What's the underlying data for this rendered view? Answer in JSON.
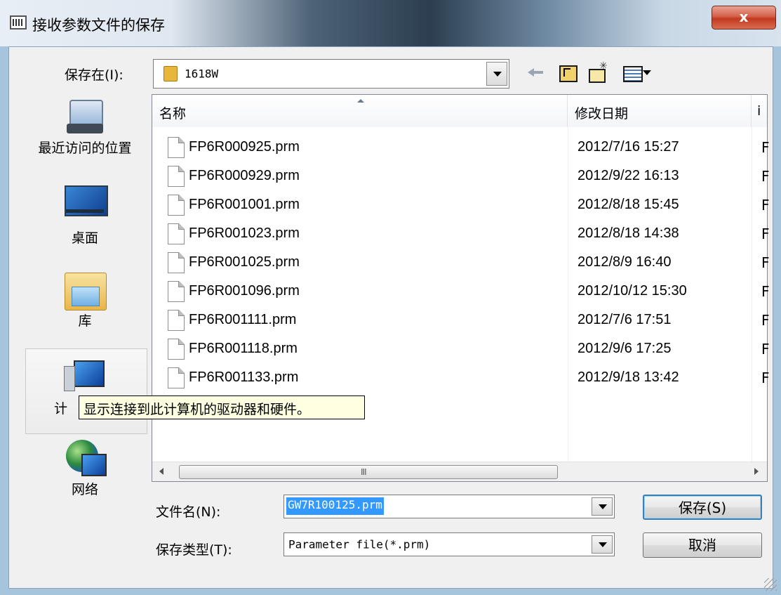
{
  "window": {
    "title": "接收参数文件的保存",
    "close_label": "x"
  },
  "save_in": {
    "label": "保存在(I):",
    "value": "1618W"
  },
  "places": [
    {
      "label": "最近访问的位置"
    },
    {
      "label": "桌面"
    },
    {
      "label": "库"
    },
    {
      "label": "计"
    },
    {
      "label": "网络"
    }
  ],
  "list": {
    "columns": [
      "名称",
      "修改日期",
      "i"
    ],
    "files": [
      {
        "name": "FP6R000925.prm",
        "date": "2012/7/16 15:27",
        "more": "F"
      },
      {
        "name": "FP6R000929.prm",
        "date": "2012/9/22 16:13",
        "more": "F"
      },
      {
        "name": "FP6R001001.prm",
        "date": "2012/8/18 15:45",
        "more": "F"
      },
      {
        "name": "FP6R001023.prm",
        "date": "2012/8/18 14:38",
        "more": "F"
      },
      {
        "name": "FP6R001025.prm",
        "date": "2012/8/9 16:40",
        "more": "F"
      },
      {
        "name": "FP6R001096.prm",
        "date": "2012/10/12 15:30",
        "more": "F"
      },
      {
        "name": "FP6R001111.prm",
        "date": "2012/7/6 17:51",
        "more": "F"
      },
      {
        "name": "FP6R001118.prm",
        "date": "2012/9/6 17:25",
        "more": "F"
      },
      {
        "name": "FP6R001133.prm",
        "date": "2012/9/18 13:42",
        "more": "F"
      }
    ],
    "scroll_grip": "III"
  },
  "tooltip": "显示连接到此计算机的驱动器和硬件。",
  "filename": {
    "label": "文件名(N):",
    "value": "GW7R100125.prm"
  },
  "filetype": {
    "label": "保存类型(T):",
    "value": "Parameter file(*.prm)"
  },
  "buttons": {
    "save": "保存(S)",
    "cancel": "取消"
  }
}
